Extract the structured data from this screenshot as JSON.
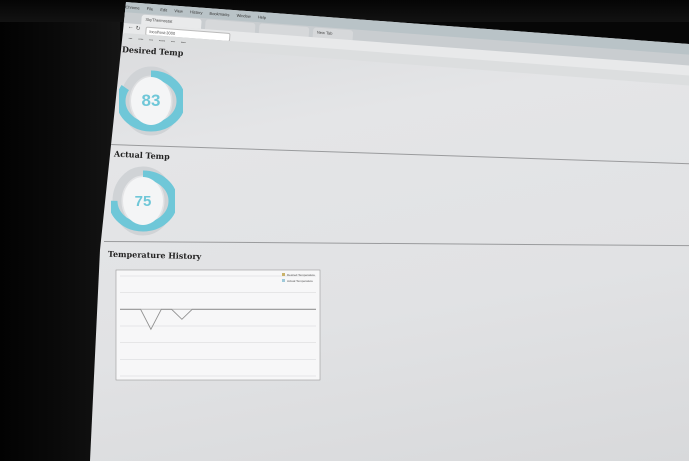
{
  "browser": {
    "tabs": [
      "SkyThermostat",
      "New Tab"
    ],
    "url": "localhost:3000",
    "menu": [
      "Chrome",
      "File",
      "Edit",
      "View",
      "History",
      "Bookmarks",
      "Window",
      "Help"
    ]
  },
  "desired": {
    "title": "Desired Temp",
    "value": "83",
    "fraction": 0.83
  },
  "actual": {
    "title": "Actual Temp",
    "value": "75",
    "fraction": 0.75
  },
  "history": {
    "title": "Temperature History"
  },
  "colors": {
    "gauge": "#6fc7d8",
    "track": "#d0d3d6",
    "line": "#aaaaaa"
  },
  "chart_data": {
    "type": "line",
    "series": [
      {
        "name": "Desired Temperature",
        "values": [
          80,
          80,
          80,
          80,
          80,
          80,
          80,
          80,
          80,
          80,
          80,
          80,
          80,
          80,
          80,
          80,
          80,
          80,
          80,
          80
        ]
      },
      {
        "name": "Actual Temperature",
        "values": [
          80,
          80,
          80,
          68,
          80,
          80,
          74,
          80,
          80,
          80,
          80,
          80,
          80,
          80,
          80,
          80,
          80,
          80,
          80,
          80
        ]
      }
    ]
  }
}
